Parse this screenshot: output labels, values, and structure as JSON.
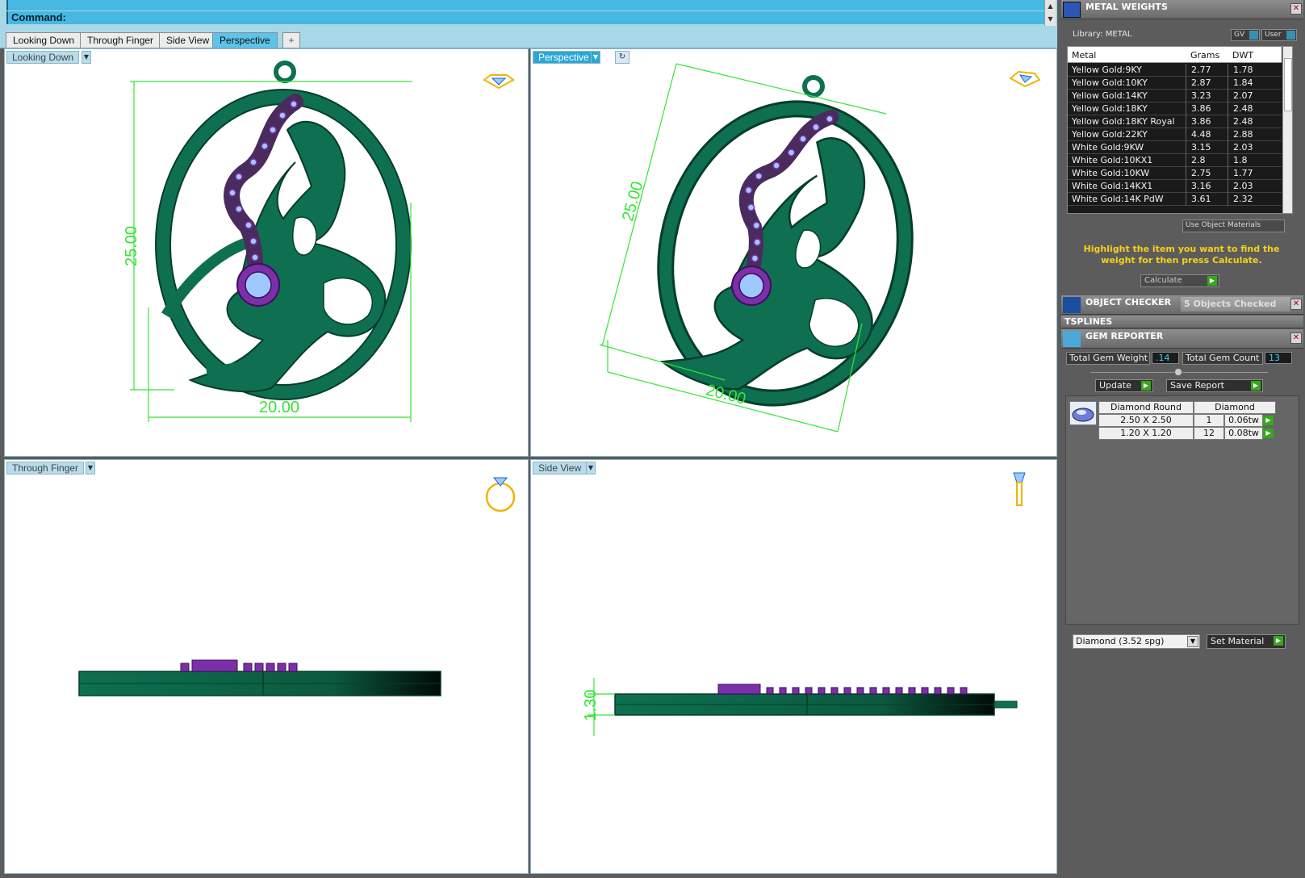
{
  "command": {
    "label": "Command:"
  },
  "tabs": [
    {
      "label": "Looking Down"
    },
    {
      "label": "Through Finger"
    },
    {
      "label": "Side View"
    },
    {
      "label": "Perspective"
    },
    {
      "label": "+"
    }
  ],
  "viewports": {
    "top_left": {
      "label": "Looking Down",
      "dim_h": "25.00",
      "dim_w": "20.00"
    },
    "top_right": {
      "label": "Perspective",
      "dim_h": "25.00",
      "dim_w": "20.00"
    },
    "bottom_left": {
      "label": "Through Finger"
    },
    "bottom_right": {
      "label": "Side View",
      "dim_thick": "1.30"
    }
  },
  "metal_weights": {
    "title": "METAL WEIGHTS",
    "library": "Library: METAL",
    "gv_label": "GV",
    "user_label": "User",
    "columns": [
      "Metal",
      "Grams",
      "DWT"
    ],
    "rows": [
      [
        "Yellow Gold:9KY",
        "2.77",
        "1.78"
      ],
      [
        "Yellow Gold:10KY",
        "2.87",
        "1.84"
      ],
      [
        "Yellow Gold:14KY",
        "3.23",
        "2.07"
      ],
      [
        "Yellow Gold:18KY",
        "3.86",
        "2.48"
      ],
      [
        "Yellow Gold:18KY Royal",
        "3.86",
        "2.48"
      ],
      [
        "Yellow Gold:22KY",
        "4.48",
        "2.88"
      ],
      [
        "White Gold:9KW",
        "3.15",
        "2.03"
      ],
      [
        "White Gold:10KX1",
        "2.8",
        "1.8"
      ],
      [
        "White Gold:10KW",
        "2.75",
        "1.77"
      ],
      [
        "White Gold:14KX1",
        "3.16",
        "2.03"
      ],
      [
        "White Gold:14K PdW",
        "3.61",
        "2.32"
      ]
    ],
    "use_object_materials": "Use Object Materials",
    "hint": "Highlight the item you want to find the weight for then press Calculate.",
    "calculate": "Calculate"
  },
  "object_checker": {
    "title": "OBJECT CHECKER",
    "status": "5 Objects Checked"
  },
  "tsplines": {
    "title": "TSPLINES"
  },
  "gem_reporter": {
    "title": "GEM REPORTER",
    "total_weight_label": "Total Gem Weight",
    "total_weight": ".14",
    "total_count_label": "Total Gem Count",
    "total_count": "13",
    "update": "Update",
    "save_report": "Save Report",
    "headers": [
      "Diamond Round",
      "Diamond"
    ],
    "rows": [
      [
        "2.50 X 2.50",
        "1",
        "0.06tw"
      ],
      [
        "1.20 X 1.20",
        "12",
        "0.08tw"
      ]
    ],
    "material": "Diamond    (3.52 spg)",
    "set_material": "Set Material"
  },
  "colors": {
    "metal_green": "#0e7050",
    "dimension_green": "#33e633",
    "gem_purple": "#7b2fa8",
    "accent_blue": "#46b8e2"
  }
}
